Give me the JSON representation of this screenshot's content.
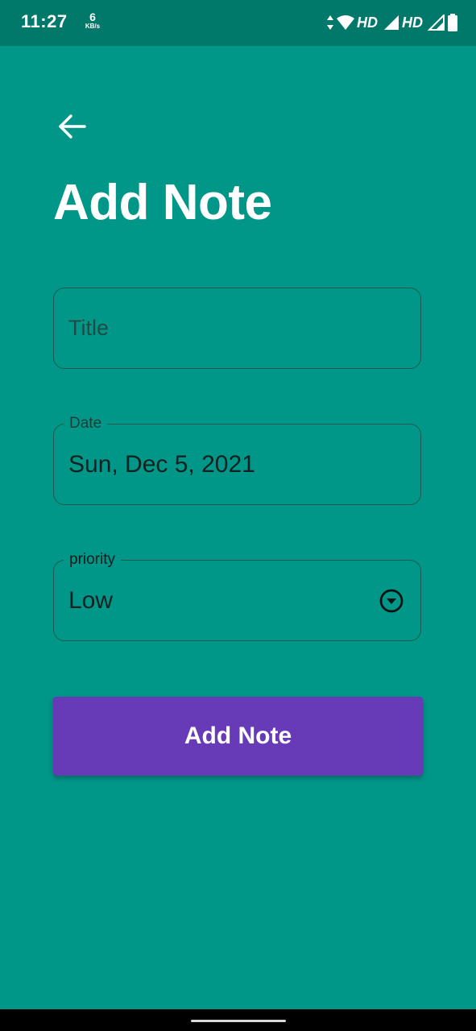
{
  "status_bar": {
    "time": "11:27",
    "network_speed_value": "6",
    "network_speed_unit": "KB/s",
    "hd_label_1": "HD",
    "hd_label_2": "HD"
  },
  "header": {
    "back_icon": "arrow-left-icon",
    "title": "Add Note"
  },
  "form": {
    "title_field": {
      "placeholder": "Title",
      "value": ""
    },
    "date_field": {
      "label": "Date",
      "value": "Sun, Dec 5, 2021"
    },
    "priority_field": {
      "label": "priority",
      "value": "Low",
      "dropdown_icon": "dropdown-circle-icon"
    },
    "submit_label": "Add Note"
  },
  "colors": {
    "background": "#009688",
    "status_bar": "#00796B",
    "button": "#673AB7",
    "text_on_primary": "#FFFFFF"
  }
}
